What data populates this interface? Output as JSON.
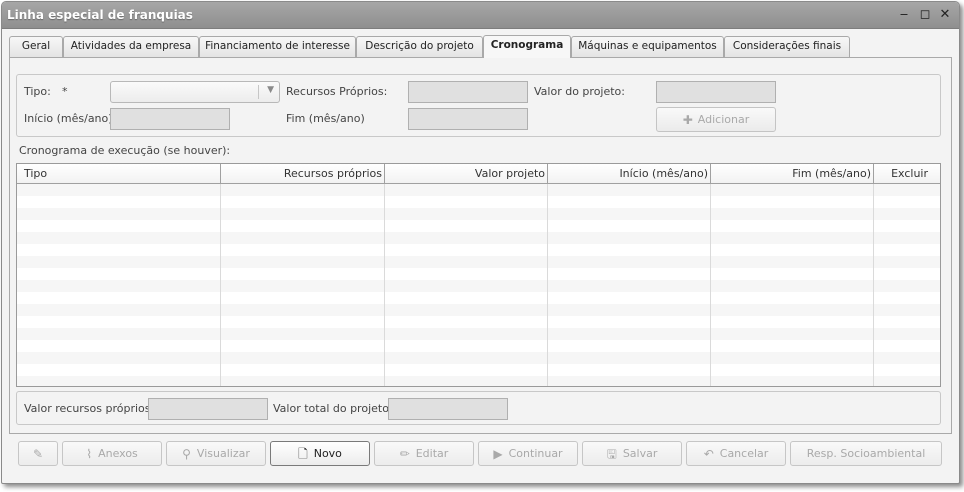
{
  "window": {
    "title": "Linha especial de franquias",
    "minimize_glyph": "‒",
    "maximize_glyph": "◻",
    "close_glyph": "✕"
  },
  "tabs": [
    {
      "label": "Geral",
      "active": false
    },
    {
      "label": "Atividades da empresa",
      "active": false
    },
    {
      "label": "Financiamento de interesse",
      "active": false
    },
    {
      "label": "Descrição do projeto",
      "active": false
    },
    {
      "label": "Cronograma",
      "active": true
    },
    {
      "label": "Máquinas e equipamentos",
      "active": false
    },
    {
      "label": "Considerações finais",
      "active": false
    }
  ],
  "form": {
    "tipo_label": "Tipo:",
    "required_mark": "*",
    "tipo_value": "",
    "recursos_proprios_label": "Recursos Próprios:",
    "recursos_proprios_value": "",
    "valor_projeto_label": "Valor do projeto:",
    "valor_projeto_value": "",
    "inicio_label": "Início (mês/ano)",
    "inicio_value": "",
    "fim_label": "Fim (mês/ano)",
    "fim_value": "",
    "add_button_label": "Adicionar",
    "add_button_icon": "plus-icon"
  },
  "grid": {
    "title": "Cronograma de execução (se houver):",
    "columns": [
      "Tipo",
      "Recursos próprios",
      "Valor projeto",
      "Início (mês/ano)",
      "Fim (mês/ano)",
      "Excluir"
    ],
    "rows": []
  },
  "totals": {
    "valor_recursos_proprios_label": "Valor recursos próprios:",
    "valor_recursos_proprios_value": "",
    "valor_total_label": "Valor total do projeto:",
    "valor_total_value": ""
  },
  "footer_buttons": [
    {
      "label": "",
      "icon": "edit-form-icon",
      "enabled": false
    },
    {
      "label": "Anexos",
      "icon": "paperclip-icon",
      "enabled": false
    },
    {
      "label": "Visualizar",
      "icon": "magnifier-icon",
      "enabled": false
    },
    {
      "label": "Novo",
      "icon": "new-document-icon",
      "enabled": true
    },
    {
      "label": "Editar",
      "icon": "pencil-icon",
      "enabled": false
    },
    {
      "label": "Continuar",
      "icon": "play-icon",
      "enabled": false
    },
    {
      "label": "Salvar",
      "icon": "save-icon",
      "enabled": false
    },
    {
      "label": "Cancelar",
      "icon": "undo-arrow-icon",
      "enabled": false
    },
    {
      "label": "Resp. Socioambiental",
      "icon": "",
      "enabled": false
    }
  ]
}
